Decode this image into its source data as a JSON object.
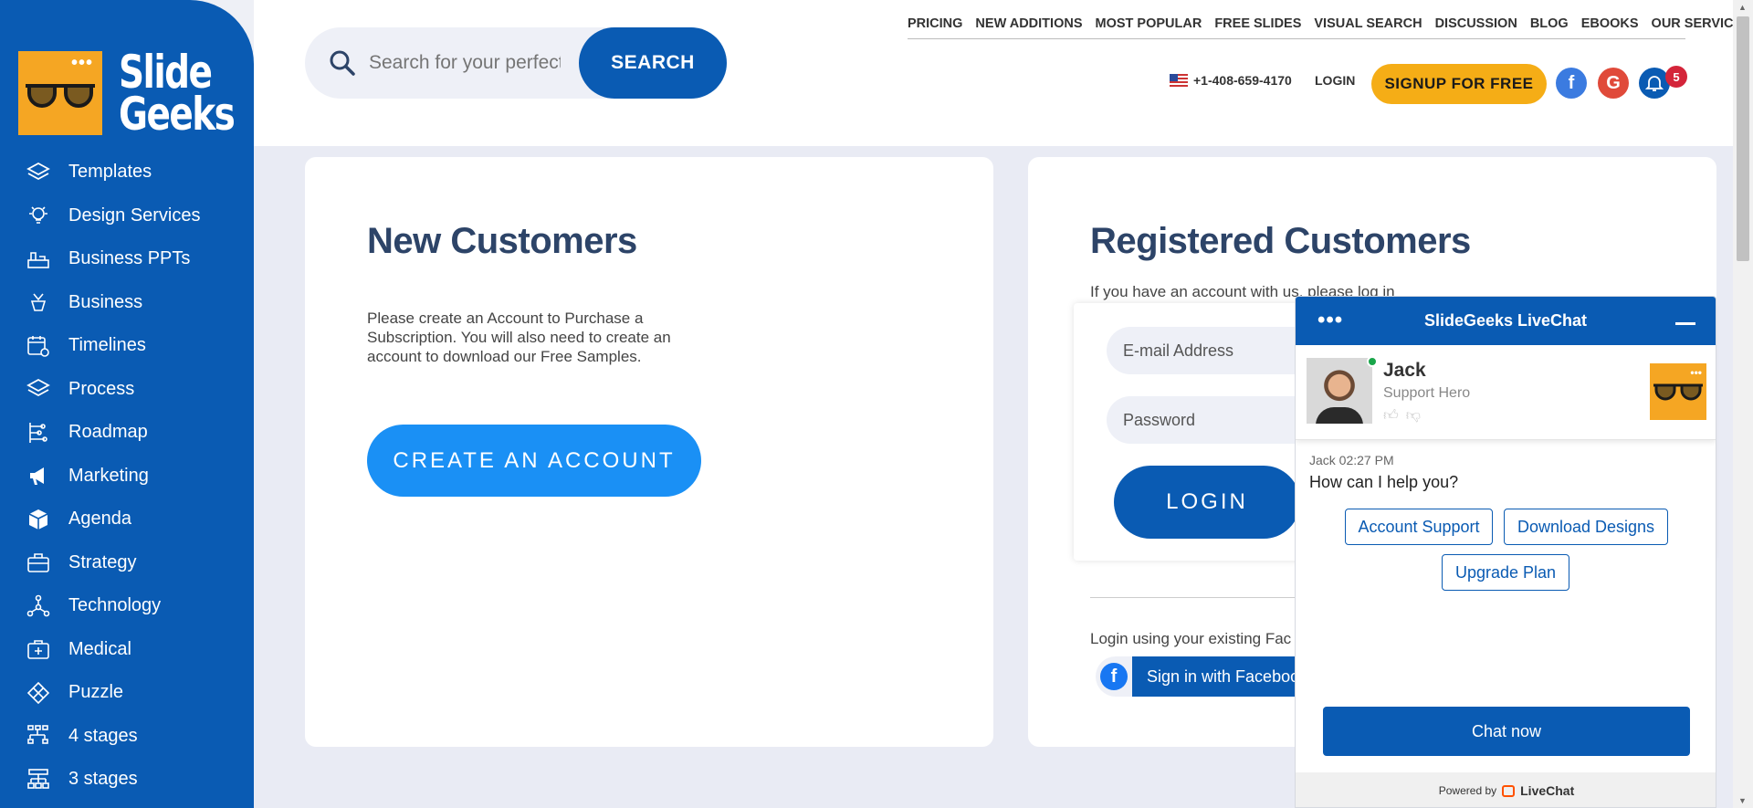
{
  "brand": {
    "line1": "Slide",
    "line2": "Geeks"
  },
  "sidebar": {
    "items": [
      {
        "label": "Templates"
      },
      {
        "label": "Design Services"
      },
      {
        "label": "Business PPTs"
      },
      {
        "label": "Business"
      },
      {
        "label": "Timelines"
      },
      {
        "label": "Process"
      },
      {
        "label": "Roadmap"
      },
      {
        "label": "Marketing"
      },
      {
        "label": "Agenda"
      },
      {
        "label": "Strategy"
      },
      {
        "label": "Technology"
      },
      {
        "label": "Medical"
      },
      {
        "label": "Puzzle"
      },
      {
        "label": "4 stages"
      },
      {
        "label": "3 stages"
      }
    ]
  },
  "search": {
    "placeholder": "Search for your perfect",
    "button": "SEARCH"
  },
  "topnav": [
    "PRICING",
    "NEW ADDITIONS",
    "MOST POPULAR",
    "FREE SLIDES",
    "VISUAL SEARCH",
    "DISCUSSION",
    "BLOG",
    "EBOOKS",
    "OUR SERVICES"
  ],
  "header": {
    "phone": "+1-408-659-4170",
    "login": "LOGIN",
    "signup": "SIGNUP FOR FREE",
    "notification_count": "5"
  },
  "new_customers": {
    "title": "New Customers",
    "text": "Please create an Account to Purchase a Subscription. You will also need to create an account to download our Free Samples.",
    "button": "CREATE AN ACCOUNT"
  },
  "registered": {
    "title": "Registered Customers",
    "subtitle": "If you have an account with us, please log in",
    "email_placeholder": "E-mail Address",
    "password_placeholder": "Password",
    "login_button": "LOGIN",
    "fb_text": "Login using your existing Fac",
    "fb_button": "Sign in with Faceboo"
  },
  "chat": {
    "title": "SlideGeeks LiveChat",
    "agent_name": "Jack",
    "agent_role": "Support Hero",
    "meta": "Jack 02:27 PM",
    "message": "How can I help you?",
    "quick_replies": [
      "Account Support",
      "Download Designs",
      "Upgrade Plan"
    ],
    "chat_now": "Chat now",
    "powered_by": "Powered by",
    "powered_brand": "LiveChat"
  },
  "colors": {
    "primary": "#0a5bb3",
    "accent": "#f5ad16",
    "create": "#1a90f5"
  }
}
